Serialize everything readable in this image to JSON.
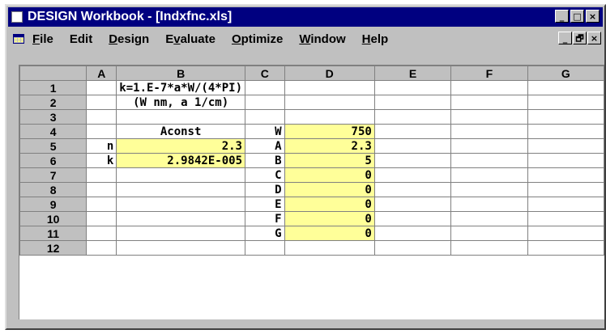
{
  "window": {
    "title": "DESIGN Workbook - [Indxfnc.xls]",
    "buttons": {
      "minimize": "_",
      "maximize": "□",
      "close": "×"
    }
  },
  "menubar": {
    "items": [
      {
        "label": "File",
        "underline": "F",
        "rest": "ile"
      },
      {
        "label": "Edit",
        "underline": "",
        "rest": "Edit"
      },
      {
        "label": "Design",
        "underline": "D",
        "rest": "esign"
      },
      {
        "label": "Evaluate",
        "pre": "E",
        "underline": "v",
        "rest": "aluate"
      },
      {
        "label": "Optimize",
        "underline": "O",
        "rest": "ptimize"
      },
      {
        "label": "Window",
        "underline": "W",
        "rest": "indow"
      },
      {
        "label": "Help",
        "underline": "H",
        "rest": "elp"
      }
    ],
    "doc_buttons": {
      "minimize": "_",
      "restore": "🗗",
      "close": "×"
    }
  },
  "sheet": {
    "columns": [
      "A",
      "B",
      "C",
      "D",
      "E",
      "F",
      "G"
    ],
    "rows": [
      {
        "n": "1",
        "A": "",
        "B": "k=1.E-7*a*W/(4*PI)",
        "C": "",
        "D": "",
        "E": "",
        "F": "",
        "G": ""
      },
      {
        "n": "2",
        "A": "",
        "B": "(W nm, a 1/cm)",
        "C": "",
        "D": "",
        "E": "",
        "F": "",
        "G": ""
      },
      {
        "n": "3",
        "A": "",
        "B": "",
        "C": "",
        "D": "",
        "E": "",
        "F": "",
        "G": ""
      },
      {
        "n": "4",
        "A": "",
        "B": "Aconst",
        "C": "W",
        "D": "750",
        "E": "",
        "F": "",
        "G": ""
      },
      {
        "n": "5",
        "A": "n",
        "B": "2.3",
        "C": "A",
        "D": "2.3",
        "E": "",
        "F": "",
        "G": ""
      },
      {
        "n": "6",
        "A": "k",
        "B": "2.9842E-005",
        "C": "B",
        "D": "5",
        "E": "",
        "F": "",
        "G": ""
      },
      {
        "n": "7",
        "A": "",
        "B": "",
        "C": "C",
        "D": "0",
        "E": "",
        "F": "",
        "G": ""
      },
      {
        "n": "8",
        "A": "",
        "B": "",
        "C": "D",
        "D": "0",
        "E": "",
        "F": "",
        "G": ""
      },
      {
        "n": "9",
        "A": "",
        "B": "",
        "C": "E",
        "D": "0",
        "E": "",
        "F": "",
        "G": ""
      },
      {
        "n": "10",
        "A": "",
        "B": "",
        "C": "F",
        "D": "0",
        "E": "",
        "F": "",
        "G": ""
      },
      {
        "n": "11",
        "A": "",
        "B": "",
        "C": "G",
        "D": "0",
        "E": "",
        "F": "",
        "G": ""
      },
      {
        "n": "12",
        "A": "",
        "B": "",
        "C": "",
        "D": "",
        "E": "",
        "F": "",
        "G": ""
      }
    ]
  },
  "colors": {
    "title_bg": "#000080",
    "highlight": "#ffff99",
    "chrome": "#c0c0c0"
  }
}
